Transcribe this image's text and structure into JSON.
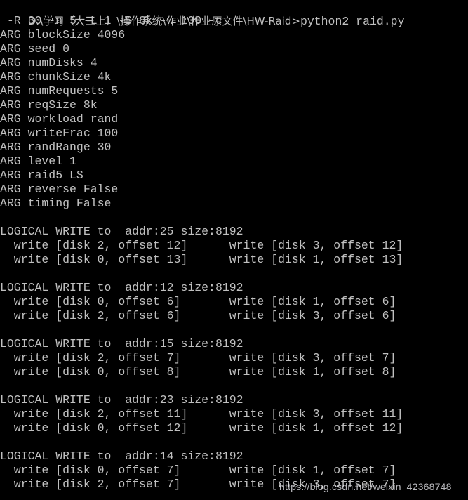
{
  "terminal": {
    "background_color": "#000000",
    "text_color": "#c0c0c0",
    "prompt_path": "D:\\学习（大三上）\\操作系统\\作业\\作业原文件\\HW-Raid>",
    "command": "python2 raid.py",
    "command_continuation": " -R 30 -n 5 -L 1 -S 8k -w 100 -c",
    "prompt_line": "D:\\学习（大三上）\\操作系统\\作业\\作业原文件\\HW-Raid>python2 raid.py",
    "args": [
      {
        "label": "ARG blockSize",
        "value": "4096",
        "line": "ARG blockSize 4096"
      },
      {
        "label": "ARG seed",
        "value": "0",
        "line": "ARG seed 0"
      },
      {
        "label": "ARG numDisks",
        "value": "4",
        "line": "ARG numDisks 4"
      },
      {
        "label": "ARG chunkSize",
        "value": "4k",
        "line": "ARG chunkSize 4k"
      },
      {
        "label": "ARG numRequests",
        "value": "5",
        "line": "ARG numRequests 5"
      },
      {
        "label": "ARG reqSize",
        "value": "8k",
        "line": "ARG reqSize 8k"
      },
      {
        "label": "ARG workload",
        "value": "rand",
        "line": "ARG workload rand"
      },
      {
        "label": "ARG writeFrac",
        "value": "100",
        "line": "ARG writeFrac 100"
      },
      {
        "label": "ARG randRange",
        "value": "30",
        "line": "ARG randRange 30"
      },
      {
        "label": "ARG level",
        "value": "1",
        "line": "ARG level 1"
      },
      {
        "label": "ARG raid5",
        "value": "LS",
        "line": "ARG raid5 LS"
      },
      {
        "label": "ARG reverse",
        "value": "False",
        "line": "ARG reverse False"
      },
      {
        "label": "ARG timing",
        "value": "False",
        "line": "ARG timing False"
      }
    ],
    "requests": [
      {
        "header": "LOGICAL WRITE to  addr:25 size:8192",
        "addr": "25",
        "size": "8192",
        "rows": [
          {
            "left": "  write [disk 2, offset 12]",
            "right": "write [disk 3, offset 12]"
          },
          {
            "left": "  write [disk 0, offset 13]",
            "right": "write [disk 1, offset 13]"
          }
        ]
      },
      {
        "header": "LOGICAL WRITE to  addr:12 size:8192",
        "addr": "12",
        "size": "8192",
        "rows": [
          {
            "left": "  write [disk 0, offset 6]",
            "right": "write [disk 1, offset 6]"
          },
          {
            "left": "  write [disk 2, offset 6]",
            "right": "write [disk 3, offset 6]"
          }
        ]
      },
      {
        "header": "LOGICAL WRITE to  addr:15 size:8192",
        "addr": "15",
        "size": "8192",
        "rows": [
          {
            "left": "  write [disk 2, offset 7]",
            "right": "write [disk 3, offset 7]"
          },
          {
            "left": "  write [disk 0, offset 8]",
            "right": "write [disk 1, offset 8]"
          }
        ]
      },
      {
        "header": "LOGICAL WRITE to  addr:23 size:8192",
        "addr": "23",
        "size": "8192",
        "rows": [
          {
            "left": "  write [disk 2, offset 11]",
            "right": "write [disk 3, offset 11]"
          },
          {
            "left": "  write [disk 0, offset 12]",
            "right": "write [disk 1, offset 12]"
          }
        ]
      },
      {
        "header": "LOGICAL WRITE to  addr:14 size:8192",
        "addr": "14",
        "size": "8192",
        "rows": [
          {
            "left": "  write [disk 0, offset 7]",
            "right": "write [disk 1, offset 7]"
          },
          {
            "left": "  write [disk 2, offset 7]",
            "right": "write [disk 3, offset 7]"
          }
        ]
      }
    ]
  },
  "watermark": {
    "text": "https://blog.csdn.net/weixin_42368748"
  },
  "lines": [
    "D:\\学习（大三上）\\操作系统\\作业\\作业原文件\\HW-Raid>python2 raid.py",
    " -R 30 -n 5 -L 1 -S 8k -w 100 -c",
    "ARG blockSize 4096",
    "ARG seed 0",
    "ARG numDisks 4",
    "ARG chunkSize 4k",
    "ARG numRequests 5",
    "ARG reqSize 8k",
    "ARG workload rand",
    "ARG writeFrac 100",
    "ARG randRange 30",
    "ARG level 1",
    "ARG raid5 LS",
    "ARG reverse False",
    "ARG timing False",
    "",
    "LOGICAL WRITE to  addr:25 size:8192",
    "  write [disk 2, offset 12]      write [disk 3, offset 12]",
    "  write [disk 0, offset 13]      write [disk 1, offset 13]",
    "",
    "LOGICAL WRITE to  addr:12 size:8192",
    "  write [disk 0, offset 6]       write [disk 1, offset 6]",
    "  write [disk 2, offset 6]       write [disk 3, offset 6]",
    "",
    "LOGICAL WRITE to  addr:15 size:8192",
    "  write [disk 2, offset 7]       write [disk 3, offset 7]",
    "  write [disk 0, offset 8]       write [disk 1, offset 8]",
    "",
    "LOGICAL WRITE to  addr:23 size:8192",
    "  write [disk 2, offset 11]      write [disk 3, offset 11]",
    "  write [disk 0, offset 12]      write [disk 1, offset 12]",
    "",
    "LOGICAL WRITE to  addr:14 size:8192",
    "  write [disk 0, offset 7]       write [disk 1, offset 7]",
    "  write [disk 2, offset 7]       write [disk 3, offset 7]"
  ]
}
